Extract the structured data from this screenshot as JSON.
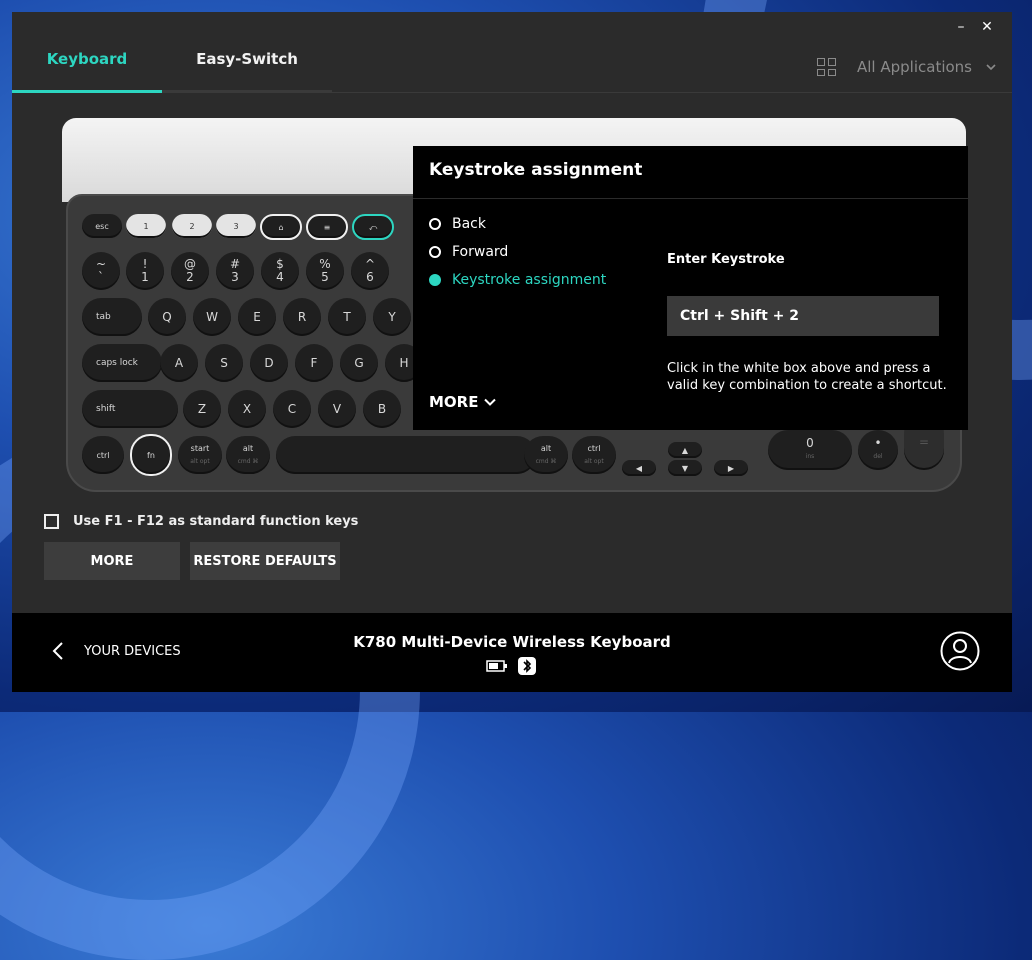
{
  "window": {
    "minimize_glyph": "–",
    "close_glyph": "✕"
  },
  "tabs": [
    {
      "label": "Keyboard",
      "active": true
    },
    {
      "label": "Easy-Switch",
      "active": false
    }
  ],
  "apps_selector": {
    "label": "All Applications",
    "icon": "grid-icon"
  },
  "keyboard": {
    "row0": [
      "esc",
      "1",
      "2",
      "3",
      "⌂",
      "≡",
      "⤺"
    ],
    "row1": [
      [
        "~",
        "`"
      ],
      [
        "!",
        "1"
      ],
      [
        "@",
        "2"
      ],
      [
        "#",
        "3"
      ],
      [
        "$",
        "4"
      ],
      [
        "%",
        "5"
      ],
      [
        "^",
        "6"
      ]
    ],
    "row2": [
      "tab",
      "Q",
      "W",
      "E",
      "R",
      "T",
      "Y"
    ],
    "row3": [
      "caps lock",
      "A",
      "S",
      "D",
      "F",
      "G",
      "H"
    ],
    "row4": [
      "shift",
      "Z",
      "X",
      "C",
      "V",
      "B"
    ],
    "row5": [
      "ctrl",
      "fn",
      "start",
      "alt"
    ],
    "row5_subs": [
      "alt opt",
      "cmd ⌘"
    ],
    "right_row5": [
      "alt",
      "ctrl"
    ],
    "right_row5_subs": [
      "cmd ⌘",
      "alt opt"
    ],
    "numpad": [
      "0",
      "•",
      "="
    ],
    "numpad_subs": [
      "ins",
      "del"
    ]
  },
  "popup": {
    "title": "Keystroke assignment",
    "options": [
      {
        "label": "Back",
        "selected": false
      },
      {
        "label": "Forward",
        "selected": false
      },
      {
        "label": "Keystroke assignment",
        "selected": true
      }
    ],
    "enter_label": "Enter Keystroke",
    "keystroke_value": "Ctrl + Shift + 2",
    "help_text": "Click in the white box above and press a valid key combination to create a shortcut.",
    "more_label": "MORE"
  },
  "settings": {
    "checkbox_label": "Use F1 - F12 as standard function keys",
    "checkbox_checked": false,
    "more_button": "MORE",
    "restore_button": "RESTORE DEFAULTS"
  },
  "footer": {
    "back_label": "YOUR DEVICES",
    "device_name": "K780 Multi-Device Wireless Keyboard",
    "icons": [
      "battery-icon",
      "bluetooth-icon"
    ]
  },
  "colors": {
    "accent": "#2dd6c1",
    "panel": "#2b2b2b",
    "popup": "#000000"
  }
}
